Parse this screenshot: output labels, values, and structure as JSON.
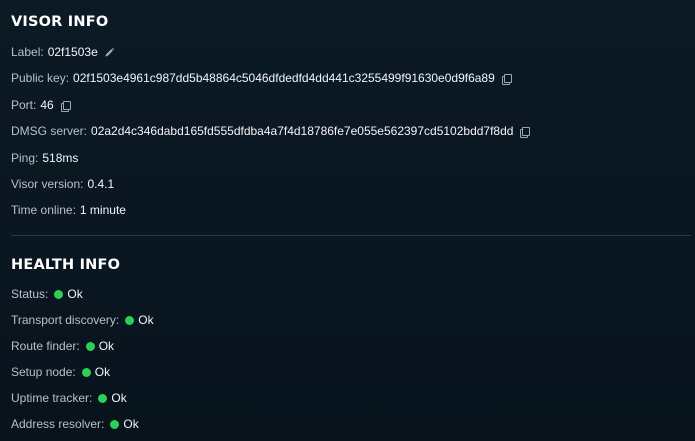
{
  "visor_info": {
    "title": "VISOR INFO",
    "label": {
      "label": "Label:",
      "value": "02f1503e",
      "icon": "pencil-icon"
    },
    "public_key": {
      "label": "Public key:",
      "value": "02f1503e4961c987dd5b48864c5046dfdedfd4dd441c3255499f91630e0d9f6a89",
      "icon": "copy-icon"
    },
    "port": {
      "label": "Port:",
      "value": "46",
      "icon": "copy-icon"
    },
    "dmsg_server": {
      "label": "DMSG server:",
      "value": "02a2d4c346dabd165fd555dfdba4a7f4d18786fe7e055e562397cd5102bdd7f8dd",
      "icon": "copy-icon"
    },
    "ping": {
      "label": "Ping:",
      "value": "518ms"
    },
    "visor_version": {
      "label": "Visor version:",
      "value": "0.4.1"
    },
    "time_online": {
      "label": "Time online:",
      "value": "1 minute"
    }
  },
  "health_info": {
    "title": "HEALTH INFO",
    "items": [
      {
        "label": "Status:",
        "value": "Ok"
      },
      {
        "label": "Transport discovery:",
        "value": "Ok"
      },
      {
        "label": "Route finder:",
        "value": "Ok"
      },
      {
        "label": "Setup node:",
        "value": "Ok"
      },
      {
        "label": "Uptime tracker:",
        "value": "Ok"
      },
      {
        "label": "Address resolver:",
        "value": "Ok"
      }
    ],
    "status_color": "#2ad05a"
  },
  "colors": {
    "background": "#0a1722",
    "text": "#f2f6f9",
    "label": "#b7c0c8",
    "divider": "#2b3843"
  }
}
